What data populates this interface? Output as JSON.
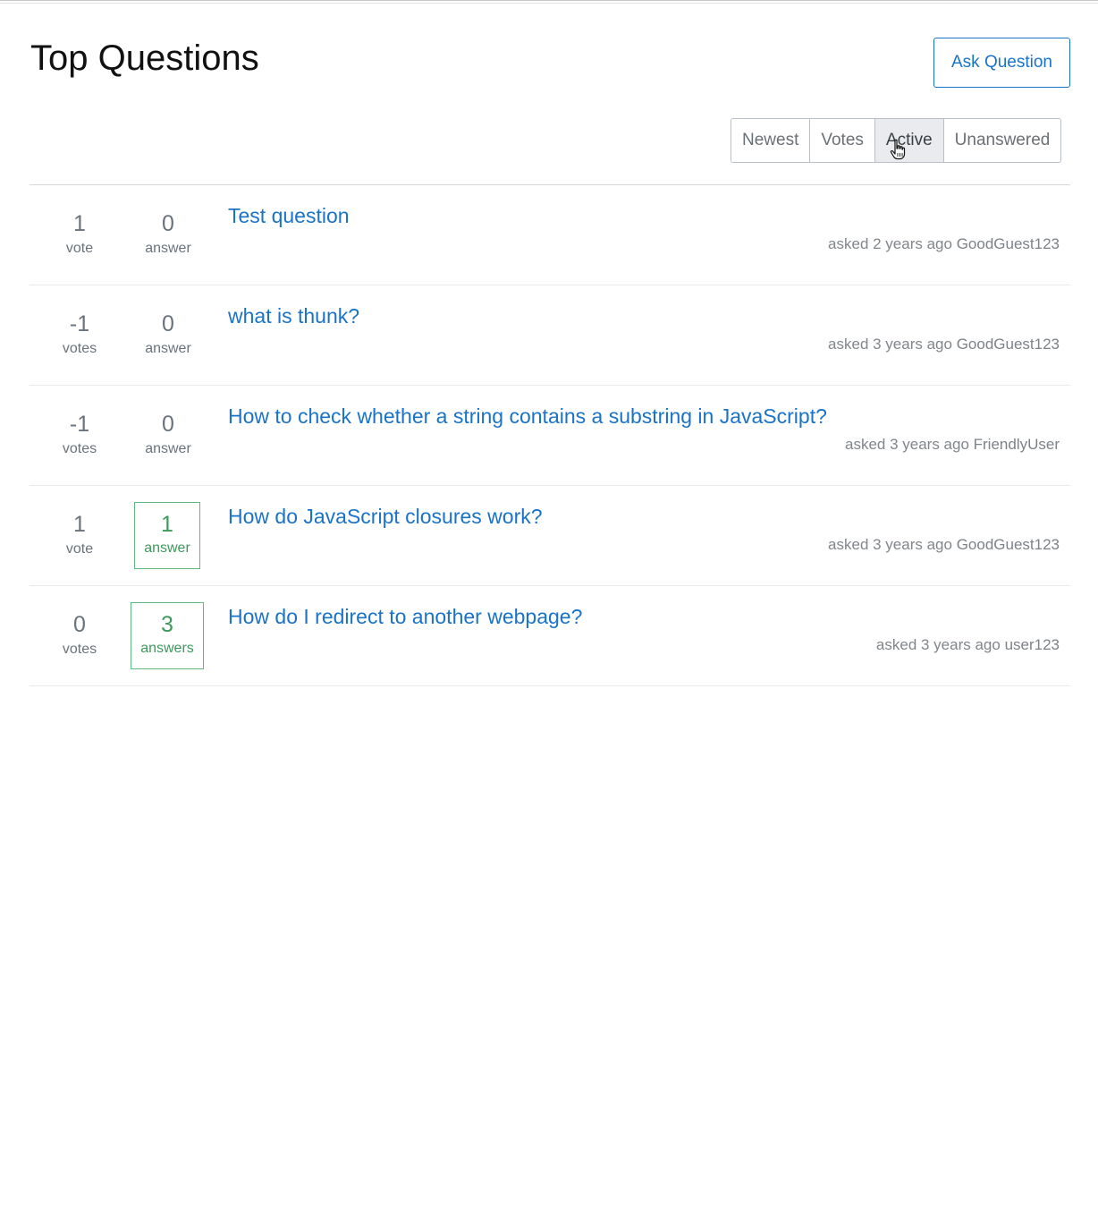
{
  "page": {
    "title": "Top Questions",
    "ask_button_label": "Ask Question"
  },
  "filters": [
    {
      "label": "Newest",
      "active": false
    },
    {
      "label": "Votes",
      "active": false
    },
    {
      "label": "Active",
      "active": true
    },
    {
      "label": "Unanswered",
      "active": false
    }
  ],
  "questions": [
    {
      "votes": "1",
      "votes_label": "vote",
      "answers": "0",
      "answers_label": "answer",
      "accepted": false,
      "title": "Test question",
      "asked": "asked 2 years ago",
      "user": "GoodGuest123"
    },
    {
      "votes": "-1",
      "votes_label": "votes",
      "answers": "0",
      "answers_label": "answer",
      "accepted": false,
      "title": "what is thunk?",
      "asked": "asked 3 years ago",
      "user": "GoodGuest123"
    },
    {
      "votes": "-1",
      "votes_label": "votes",
      "answers": "0",
      "answers_label": "answer",
      "accepted": false,
      "title": "How to check whether a string contains a substring in JavaScript?",
      "asked": "asked 3 years ago",
      "user": "FriendlyUser"
    },
    {
      "votes": "1",
      "votes_label": "vote",
      "answers": "1",
      "answers_label": "answer",
      "accepted": true,
      "title": "How do JavaScript closures work?",
      "asked": "asked 3 years ago",
      "user": "GoodGuest123"
    },
    {
      "votes": "0",
      "votes_label": "votes",
      "answers": "3",
      "answers_label": "answers",
      "accepted": true,
      "title": "How do I redirect to another webpage?",
      "asked": "asked 3 years ago",
      "user": "user123"
    }
  ],
  "colors": {
    "link": "#1a73c8",
    "accepted": "#3d9a5c",
    "muted": "#6a737c"
  },
  "icons": {
    "cursor": "hand-pointer-icon"
  }
}
